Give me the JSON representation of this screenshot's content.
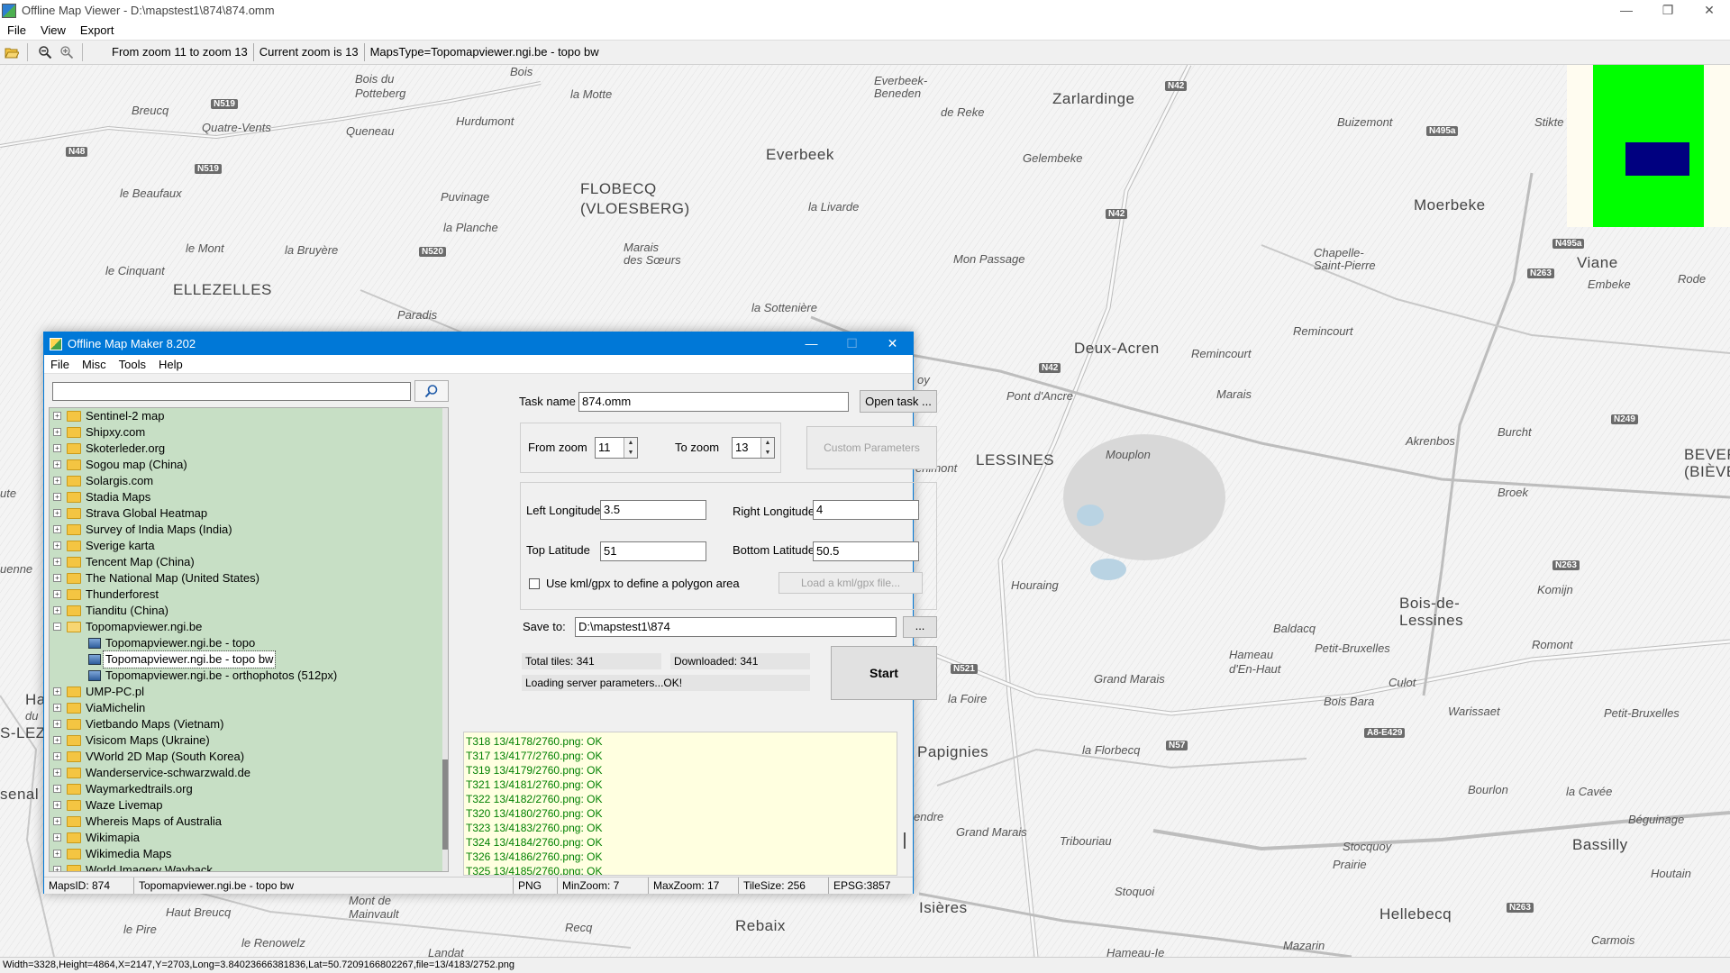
{
  "window": {
    "title": "Offline Map Viewer - D:\\mapstest1\\874\\874.omm",
    "minimize": "—",
    "maximize": "❐",
    "close": "✕"
  },
  "menu": [
    "File",
    "View",
    "Export"
  ],
  "toolbar": {
    "zoom_range": "From zoom 11 to zoom 13",
    "current_zoom": "Current zoom is 13",
    "maps_type": "MapsType=Topomapviewer.ngi.be - topo bw"
  },
  "map": {
    "places": [
      {
        "text": "Bois du"
      },
      {
        "text": "Potteberg"
      },
      {
        "text": "Bois"
      },
      {
        "text": "la Motte"
      },
      {
        "text": "Breucq"
      },
      {
        "text": "Hurdumont"
      },
      {
        "text": "Quatre-Vents"
      },
      {
        "text": "Queneau"
      },
      {
        "text": "Everbeek-"
      },
      {
        "text": "Beneden"
      },
      {
        "text": "de Reke"
      },
      {
        "text": "Zarlardinge"
      },
      {
        "text": "Buizemont"
      },
      {
        "text": "Stikte"
      },
      {
        "text": "Everbeek"
      },
      {
        "text": "Gelembeke"
      },
      {
        "text": "FLOBECQ"
      },
      {
        "text": "(VLOESBERG)"
      },
      {
        "text": "le Beaufaux"
      },
      {
        "text": "Puvinage"
      },
      {
        "text": "la Livarde"
      },
      {
        "text": "Moerbeke"
      },
      {
        "text": "la Planche"
      },
      {
        "text": "le Mont"
      },
      {
        "text": "la Bruyère"
      },
      {
        "text": "Marais"
      },
      {
        "text": "des Sœurs"
      },
      {
        "text": "Mon Passage"
      },
      {
        "text": "Chapelle-"
      },
      {
        "text": "Saint-Pierre"
      },
      {
        "text": "Viane"
      },
      {
        "text": "Embeke"
      },
      {
        "text": "Rode"
      },
      {
        "text": "le Cinquant"
      },
      {
        "text": "ELLEZELLES"
      },
      {
        "text": "la Sottenière"
      },
      {
        "text": "Paradis"
      },
      {
        "text": "Remincourt"
      },
      {
        "text": "Remincourt"
      },
      {
        "text": "Deux-Acren"
      },
      {
        "text": "oy"
      },
      {
        "text": "Pont d'Ancre"
      },
      {
        "text": "Marais"
      },
      {
        "text": "Burcht"
      },
      {
        "text": "LESSINES"
      },
      {
        "text": "Mouplon"
      },
      {
        "text": "Akrenbos"
      },
      {
        "text": "BEVER"
      },
      {
        "text": "(BIÈVE"
      },
      {
        "text": "enimont"
      },
      {
        "text": "Broek"
      },
      {
        "text": "Houraing"
      },
      {
        "text": "Komijn"
      },
      {
        "text": "Bois-de-"
      },
      {
        "text": "Lessines"
      },
      {
        "text": "Baldacq"
      },
      {
        "text": "Petit-Bruxelles"
      },
      {
        "text": "Romont"
      },
      {
        "text": "Hameau"
      },
      {
        "text": "d'En-Haut"
      },
      {
        "text": "Grand Marais"
      },
      {
        "text": "Culot"
      },
      {
        "text": "la Foire"
      },
      {
        "text": "Bois Bara"
      },
      {
        "text": "Warissaet"
      },
      {
        "text": "Petit-Bruxelles"
      },
      {
        "text": "Papignies"
      },
      {
        "text": "la Florbecq"
      },
      {
        "text": "Bourlon"
      },
      {
        "text": "la Cavée"
      },
      {
        "text": "endre"
      },
      {
        "text": "Grand Marais"
      },
      {
        "text": "Tribouriau"
      },
      {
        "text": "Béguinage"
      },
      {
        "text": "Stocquoy"
      },
      {
        "text": "Bassilly"
      },
      {
        "text": "Prairie"
      },
      {
        "text": "Houtain"
      },
      {
        "text": "Stoquoi"
      },
      {
        "text": "Isières"
      },
      {
        "text": "Hellebecq"
      },
      {
        "text": "Haut Breucq"
      },
      {
        "text": "Mont de"
      },
      {
        "text": "Mainvault"
      },
      {
        "text": "Recq"
      },
      {
        "text": "Rebaix"
      },
      {
        "text": "le Pire"
      },
      {
        "text": "le Renowelz"
      },
      {
        "text": "Carmois"
      },
      {
        "text": "Mazarin"
      },
      {
        "text": "S-LEZ"
      },
      {
        "text": "senal"
      },
      {
        "text": "uenne"
      },
      {
        "text": "Ha"
      },
      {
        "text": "du"
      },
      {
        "text": "ute"
      },
      {
        "text": "Landat"
      },
      {
        "text": "Hameau-Ie"
      }
    ],
    "roads": [
      {
        "text": "N519"
      },
      {
        "text": "N48"
      },
      {
        "text": "N519"
      },
      {
        "text": "N520"
      },
      {
        "text": "N42"
      },
      {
        "text": "N42"
      },
      {
        "text": "N495a"
      },
      {
        "text": "N495a"
      },
      {
        "text": "N263"
      },
      {
        "text": "N42"
      },
      {
        "text": "N249"
      },
      {
        "text": "N263"
      },
      {
        "text": "N521"
      },
      {
        "text": "N57"
      },
      {
        "text": "A8-E429"
      },
      {
        "text": "N263"
      }
    ]
  },
  "statusbar": "Width=3328,Height=4864,X=2147,Y=2703,Long=3.84023666381836,Lat=50.7209166802267,file=13/4183/2752.png",
  "dialog": {
    "title": "Offline Map Maker 8.202",
    "menu": [
      "File",
      "Misc",
      "Tools",
      "Help"
    ],
    "search_placeholder": "",
    "tree": [
      {
        "label": "Sentinel-2 map"
      },
      {
        "label": "Shipxy.com"
      },
      {
        "label": "Skoterleder.org"
      },
      {
        "label": "Sogou map (China)"
      },
      {
        "label": "Solargis.com"
      },
      {
        "label": "Stadia Maps"
      },
      {
        "label": "Strava Global Heatmap"
      },
      {
        "label": "Survey of India Maps (India)"
      },
      {
        "label": "Sverige karta"
      },
      {
        "label": "Tencent Map (China)"
      },
      {
        "label": "The National Map (United States)"
      },
      {
        "label": "Thunderforest"
      },
      {
        "label": "Tianditu (China)"
      },
      {
        "label": "Topomapviewer.ngi.be",
        "expanded": true
      },
      {
        "label": "Topomapviewer.ngi.be - topo",
        "child": true
      },
      {
        "label": "Topomapviewer.ngi.be - topo bw",
        "child": true,
        "selected": true
      },
      {
        "label": "Topomapviewer.ngi.be - orthophotos (512px)",
        "child": true
      },
      {
        "label": "UMP-PC.pl"
      },
      {
        "label": "ViaMichelin"
      },
      {
        "label": "Vietbando Maps (Vietnam)"
      },
      {
        "label": "Visicom Maps (Ukraine)"
      },
      {
        "label": "VWorld 2D Map (South Korea)"
      },
      {
        "label": "Wanderservice-schwarzwald.de"
      },
      {
        "label": "Waymarkedtrails.org"
      },
      {
        "label": "Waze Livemap"
      },
      {
        "label": "Whereis Maps of Australia"
      },
      {
        "label": "Wikimapia"
      },
      {
        "label": "Wikimedia Maps"
      },
      {
        "label": "World Imagery Wayback"
      }
    ],
    "task_name_label": "Task name",
    "task_name_value": "874.omm",
    "open_task": "Open task ...",
    "from_zoom_label": "From zoom",
    "from_zoom_value": "11",
    "to_zoom_label": "To zoom",
    "to_zoom_value": "13",
    "custom_params": "Custom Parameters",
    "left_lon_label": "Left Longitude",
    "left_lon_value": "3.5",
    "right_lon_label": "Right Longitude",
    "right_lon_value": "4",
    "top_lat_label": "Top Latitude",
    "top_lat_value": "51",
    "bottom_lat_label": "Bottom Latitude",
    "bottom_lat_value": "50.5",
    "kml_label": "Use kml/gpx to define a polygon area",
    "load_kml": "Load a kml/gpx file...",
    "save_to_label": "Save to:",
    "save_to_value": "D:\\mapstest1\\874",
    "browse": "...",
    "total_tiles": "Total tiles: 341",
    "downloaded": "Downloaded: 341",
    "loading": "Loading server parameters...OK!",
    "start": "Start",
    "log": [
      "T318 13/4178/2760.png: OK",
      "T317 13/4177/2760.png: OK",
      "T319 13/4179/2760.png: OK",
      "T321 13/4181/2760.png: OK",
      "T322 13/4182/2760.png: OK",
      "T320 13/4180/2760.png: OK",
      "T323 13/4183/2760.png: OK",
      "T324 13/4184/2760.png: OK",
      "T326 13/4186/2760.png: OK",
      "T325 13/4185/2760.png: OK"
    ],
    "status": {
      "maps_id": "MapsID: 874",
      "map_name": "Topomapviewer.ngi.be - topo bw",
      "format": "PNG",
      "min_zoom": "MinZoom: 7",
      "max_zoom": "MaxZoom: 17",
      "tile_size": "TileSize: 256",
      "epsg": "EPSG:3857"
    }
  },
  "colors": {
    "accent": "#0078d7",
    "tree_bg": "#c7dfc5",
    "log_bg": "#ffffe0",
    "log_text": "#008000",
    "minimap_green": "#00ff00",
    "minimap_blue": "#000080"
  },
  "icons": {
    "open": "folder-open-icon",
    "zoom_out": "zoom-out-icon",
    "zoom_in": "zoom-in-icon",
    "search": "search-icon"
  }
}
